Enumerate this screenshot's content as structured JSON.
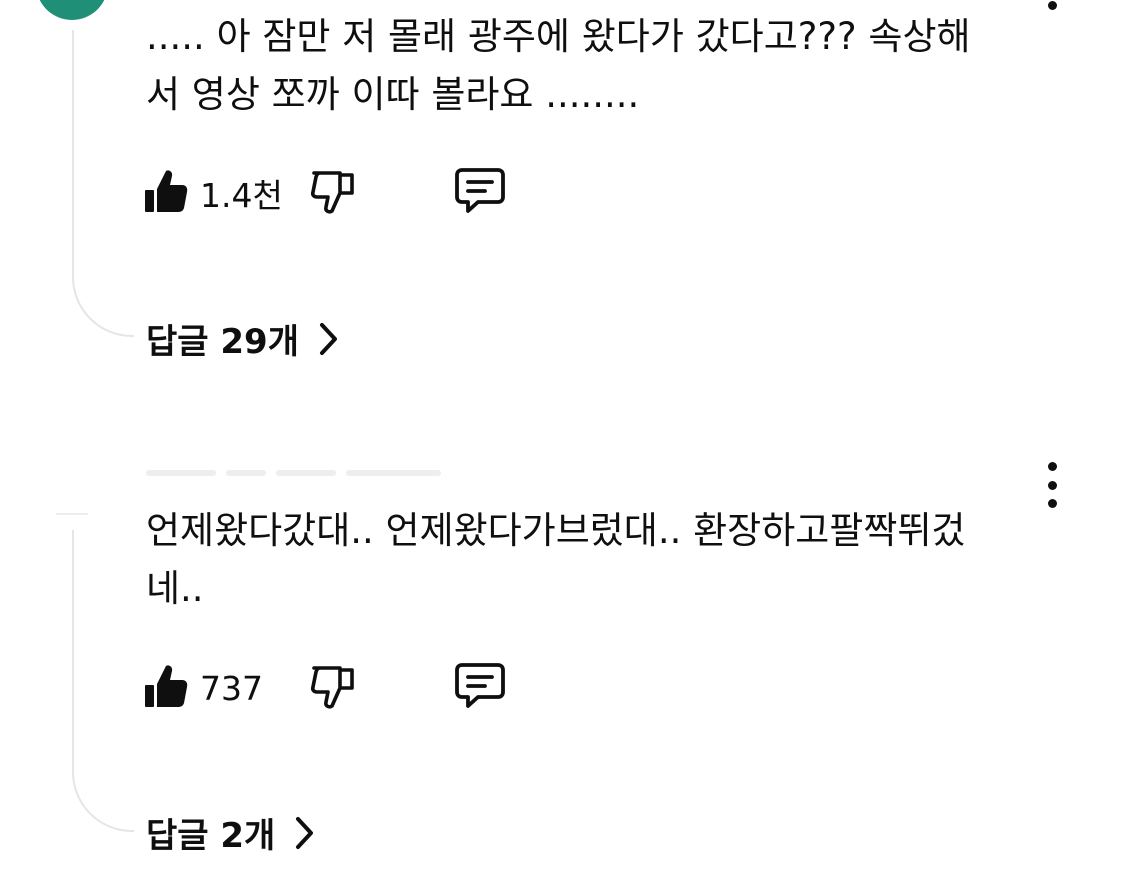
{
  "comments": [
    {
      "text_line1": "..... 아 잠만 저 몰래 광주에 왔다가 갔다고??? 속상해",
      "text_line2": "서 영상 쪼까 이따 볼라요 ........",
      "likes": "1.4천",
      "replies_label": "답글 29개"
    },
    {
      "text_line1": "언제왔다갔대.. 언제왔다가브렀대.. 환장하고팔짝뛰겄",
      "text_line2": "네..",
      "likes": "737",
      "replies_label": "답글 2개"
    }
  ],
  "icons": {
    "like": "thumbs-up-icon",
    "dislike": "thumbs-down-icon",
    "reply": "comment-icon",
    "more": "more-vert-icon",
    "chevron": "chevron-right-icon"
  },
  "colors": {
    "avatar": "#1f8f78",
    "thread_line": "#e5e5e5",
    "text": "#0f0f0f"
  }
}
